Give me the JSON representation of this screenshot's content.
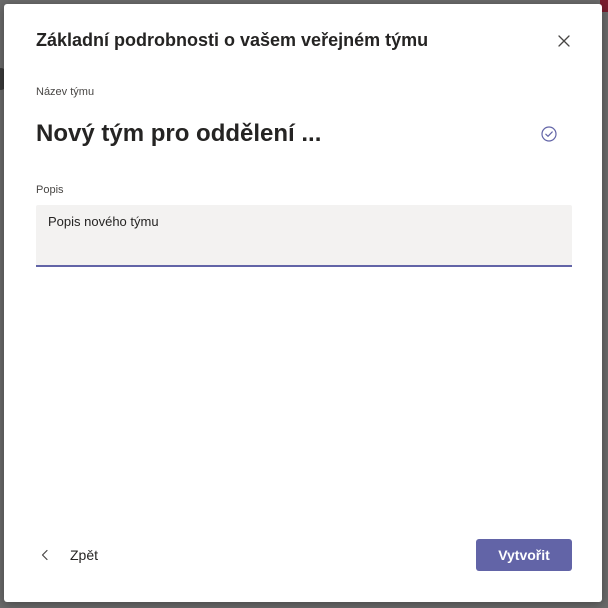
{
  "dialog": {
    "title": "Základní podrobnosti o vašem veřejném týmu",
    "close_icon": "close-icon"
  },
  "team_name": {
    "label": "Název týmu",
    "value": "Nový tým pro oddělení ...",
    "status_icon": "check-circle-icon"
  },
  "description": {
    "label": "Popis",
    "value": "Popis nového týmu"
  },
  "footer": {
    "back_label": "Zpět",
    "back_icon": "chevron-left-icon",
    "create_label": "Vytvořit"
  },
  "colors": {
    "accent": "#6264a7",
    "text": "#252423",
    "input_bg": "#f3f2f1"
  }
}
